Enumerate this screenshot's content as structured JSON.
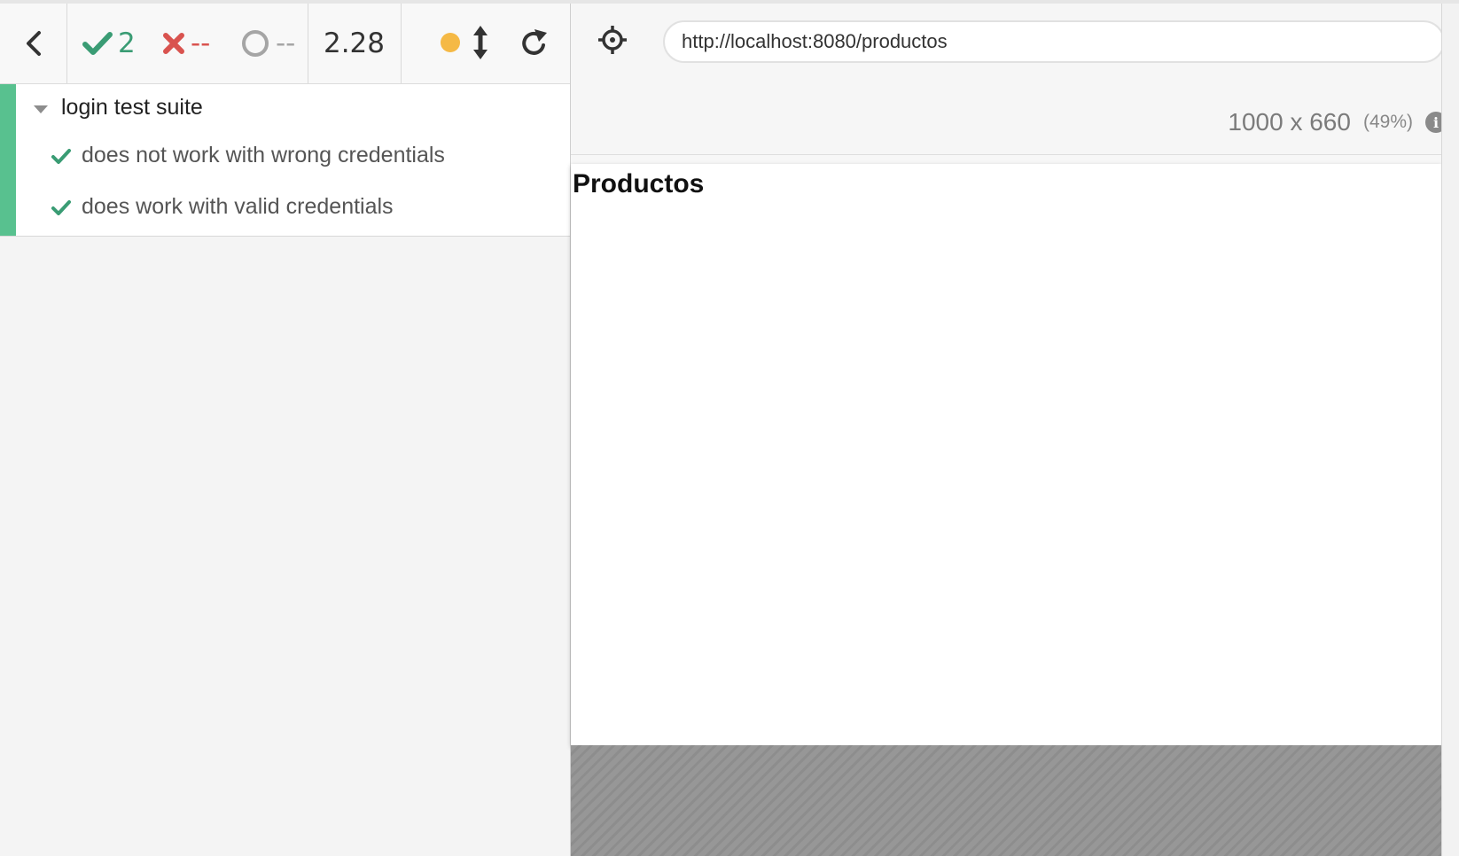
{
  "reporter": {
    "stats": {
      "passed": "2",
      "failed": "--",
      "pending": "--"
    },
    "duration": "2.28",
    "suite": {
      "title": "login test suite",
      "tests": [
        {
          "title": "does not work with wrong credentials",
          "state": "passed"
        },
        {
          "title": "does work with valid credentials",
          "state": "passed"
        }
      ]
    }
  },
  "preview": {
    "url": "http://localhost:8080/productos",
    "viewport": {
      "size": "1000 x 660",
      "scale": "(49%)"
    },
    "page": {
      "heading": "Productos"
    }
  },
  "colors": {
    "pass": "#3a9c74",
    "fail": "#d9534f",
    "pending": "#a5a5a5",
    "status_dot": "#f5b945",
    "suite_bar": "#58c18f"
  },
  "icons": [
    "back-chevron-icon",
    "check-icon",
    "cross-icon",
    "pending-circle-icon",
    "vertical-resize-icon",
    "reload-icon",
    "crosshair-icon",
    "info-icon",
    "caret-down-icon"
  ]
}
